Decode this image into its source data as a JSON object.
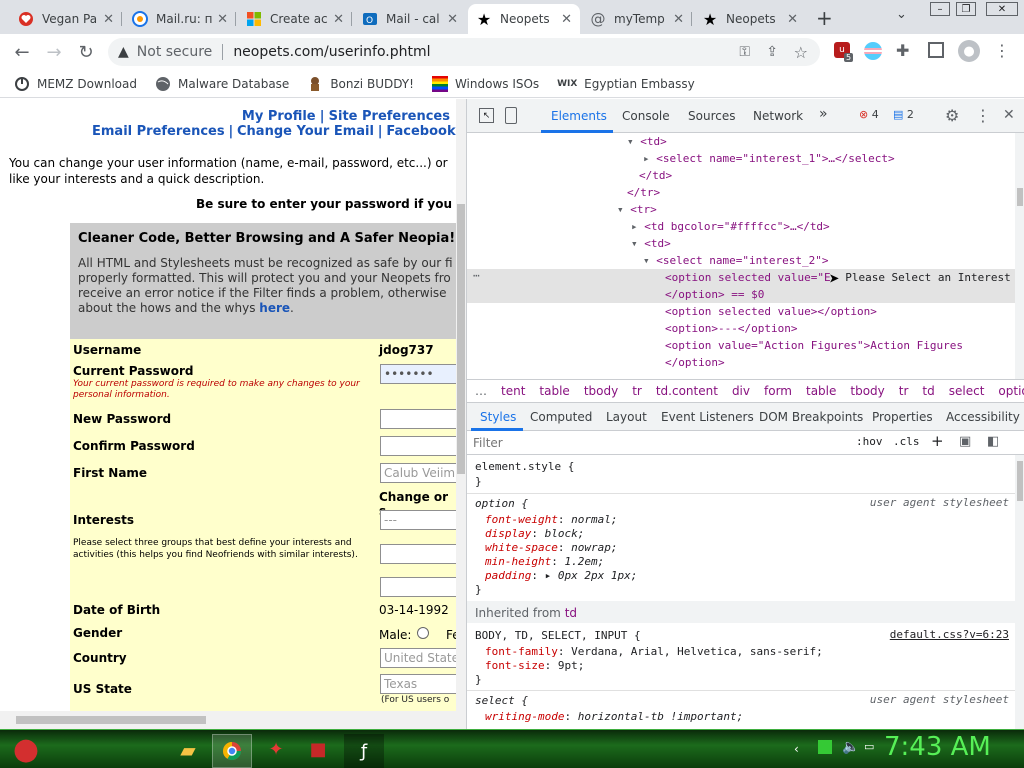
{
  "tabs": [
    {
      "title": "Vegan Pa",
      "icon": "heart-icon",
      "active": false
    },
    {
      "title": "Mail.ru: п",
      "icon": "at-icon",
      "active": false
    },
    {
      "title": "Create ac",
      "icon": "windows-icon",
      "active": false
    },
    {
      "title": "Mail - cal",
      "icon": "outlook-icon",
      "active": false
    },
    {
      "title": "Neopets",
      "icon": "star-icon",
      "active": true
    },
    {
      "title": "myTemp",
      "icon": "at-icon",
      "active": false
    },
    {
      "title": "Neopets",
      "icon": "star-icon",
      "active": false
    }
  ],
  "omnibox": {
    "security": "Not secure",
    "url": "neopets.com/userinfo.phtml",
    "ext_badge": "5"
  },
  "bookmarks": [
    "MEMZ Download",
    "Malware Database",
    "Bonzi BUDDY!",
    "Windows ISOs",
    "Egyptian Embassy"
  ],
  "page": {
    "links1": [
      "My Profile",
      "Site Preferences"
    ],
    "links2": [
      "Email Preferences",
      "Change Your Email",
      "Facebook Co"
    ],
    "intro1": "You can change your user information (name, e-mail, password, etc...) or",
    "intro2": "like your interests and a quick description.",
    "notice": "Be sure to enter your password if you",
    "filter_title": "Cleaner Code, Better Browsing and A Safer Neopia!",
    "filter_lines": [
      "All HTML and Stylesheets must be recognized as safe by our fi",
      "properly formatted. This will protect you and your Neopets fro",
      "receive an error notice if the Filter finds a problem, otherwise",
      "about the hows and the whys"
    ],
    "filter_link": "here",
    "username_label": "Username",
    "username": "jdog737",
    "current_pw_label": "Current Password",
    "current_pw_note": "Your current password is required to make any changes to your personal information.",
    "current_pw_value": "•••••••",
    "new_pw_label": "New Password",
    "confirm_pw_label": "Confirm Password",
    "first_name_label": "First Name",
    "first_name_placeholder": "Calub Veiim",
    "change_or": "Change or s",
    "interests_label": "Interests",
    "interests_note": "Please select three groups that best define your interests and activities (this helps you find Neofriends with similar interests).",
    "interest_value": "---",
    "dob_label": "Date of Birth",
    "dob": "03-14-1992",
    "gender_label": "Gender",
    "gender_male": "Male:",
    "gender_f": "Fe",
    "country_label": "Country",
    "country": "United State",
    "state_label": "US State",
    "state": "Texas",
    "state_note": "(For US users o"
  },
  "devtools": {
    "tabs": [
      "Elements",
      "Console",
      "Sources",
      "Network"
    ],
    "errors": "4",
    "messages": "2",
    "dom_lines": [
      "<td>",
      "<select name=\"interest_1\">…</select>",
      "</td>",
      "</tr>",
      "<tr>",
      "<td bgcolor=\"#ffffcc\">…</td>",
      "<td>",
      "<select name=\"interest_2\">",
      "<option selected value=\"E",
      "Please Select an Interest",
      "</option> == $0",
      "<option selected value></option>",
      "<option>---</option>",
      "<option value=\"Action Figures\">Action Figures",
      "</option>"
    ],
    "breadcrumbs": [
      "…",
      "tent",
      "table",
      "tbody",
      "tr",
      "td.content",
      "div",
      "form",
      "table",
      "tbody",
      "tr",
      "td",
      "select",
      "option"
    ],
    "style_tabs": [
      "Styles",
      "Computed",
      "Layout",
      "Event Listeners",
      "DOM Breakpoints",
      "Properties",
      "Accessibility"
    ],
    "filter_placeholder": "Filter",
    "hov": ":hov",
    "cls": ".cls",
    "styles": [
      {
        "selector": "element.style {",
        "source": ""
      },
      {
        "selector": "option {",
        "source": "user agent stylesheet"
      },
      {
        "selector": "BODY, TD, SELECT, INPUT {",
        "source": "default.css?v=6:23"
      },
      {
        "selector": "select {",
        "source": "user agent stylesheet"
      }
    ],
    "option_props": [
      [
        "font-weight",
        "normal;"
      ],
      [
        "display",
        "block;"
      ],
      [
        "white-space",
        "nowrap;"
      ],
      [
        "min-height",
        "1.2em;"
      ],
      [
        "padding",
        "▸ 0px 2px 1px;"
      ]
    ],
    "inherited": "Inherited from",
    "inherited_el": "td",
    "body_props": [
      [
        "font-family",
        "Verdana, Arial, Helvetica, sans-serif;"
      ],
      [
        "font-size",
        "9pt;"
      ]
    ],
    "select_props": [
      [
        "writing-mode",
        "horizontal-tb !important;"
      ]
    ]
  },
  "taskbar": {
    "clock": "7:43 AM"
  }
}
